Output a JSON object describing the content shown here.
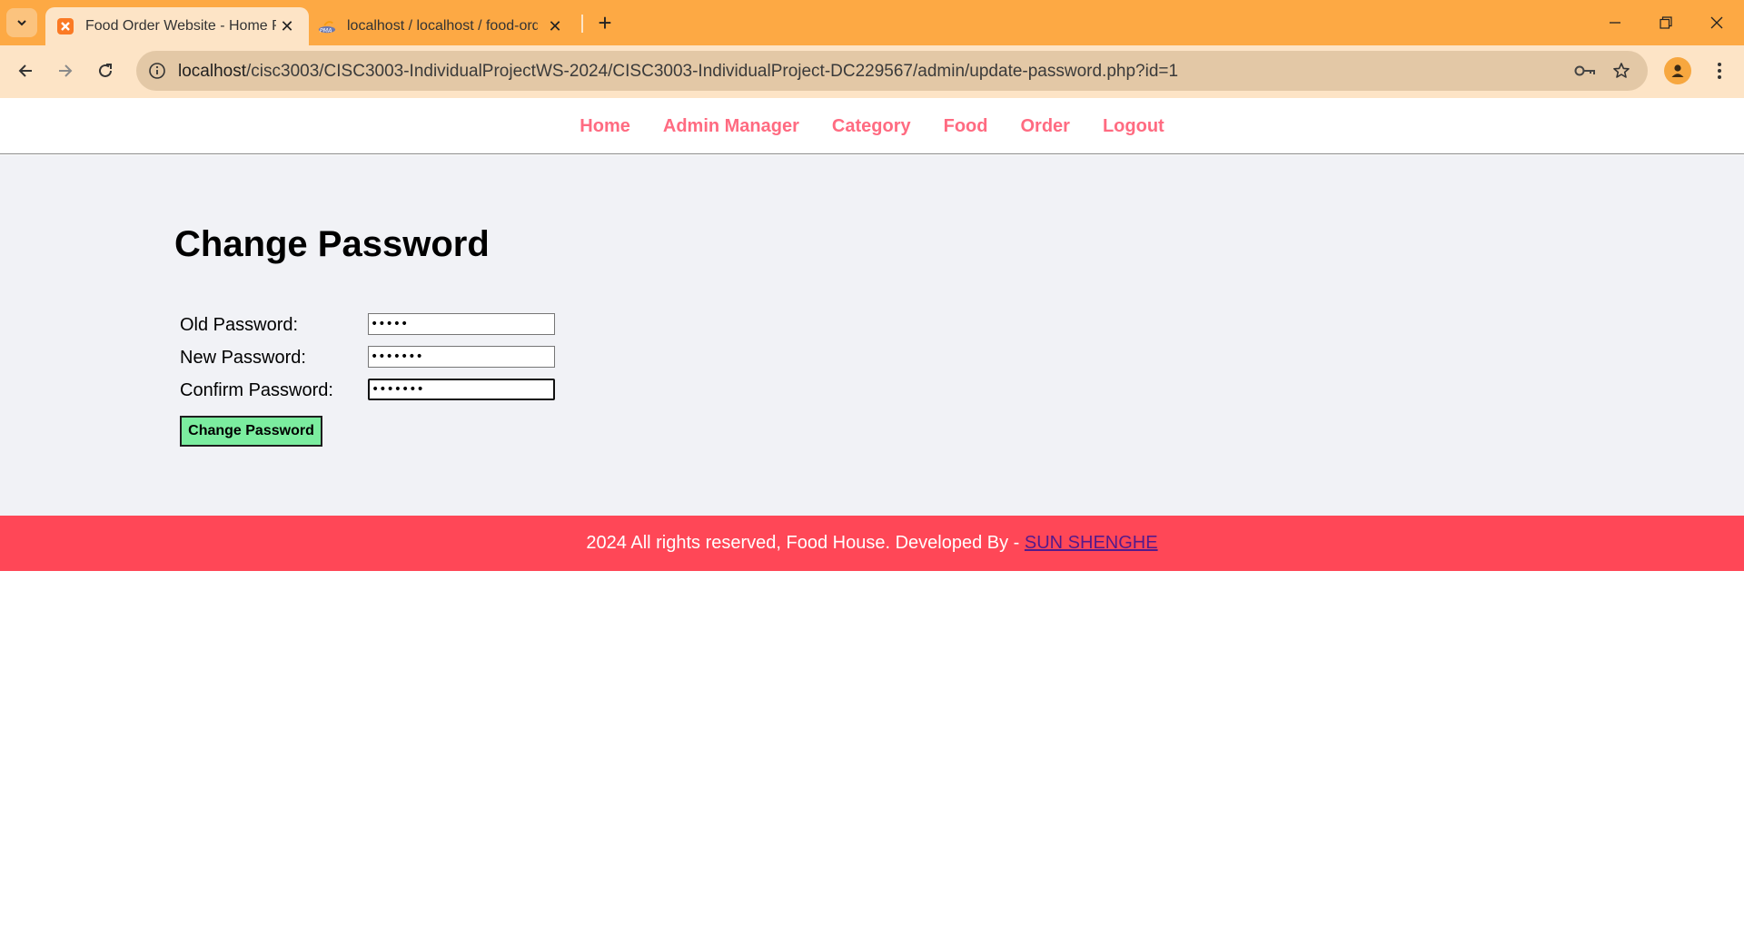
{
  "browser": {
    "tabs": [
      {
        "title": "Food Order Website - Home Page",
        "active": true
      },
      {
        "title": "localhost / localhost / food-order",
        "active": false
      }
    ],
    "url": {
      "host": "localhost",
      "path": "/cisc3003/CISC3003-IndividualProjectWS-2024/CISC3003-IndividualProject-DC229567/admin/update-password.php?id=1"
    },
    "accent_color": "#fda944"
  },
  "menu": {
    "items": [
      "Home",
      "Admin Manager",
      "Category",
      "Food",
      "Order",
      "Logout"
    ],
    "color": "#ff6b81"
  },
  "main": {
    "title": "Change Password",
    "fields": [
      {
        "label": "Old Password:",
        "value": "•••••"
      },
      {
        "label": "New Password:",
        "value": "•••••••"
      },
      {
        "label": "Confirm Password:",
        "value": "•••••••"
      }
    ],
    "submit_label": "Change Password",
    "submit_color": "#7bed9f"
  },
  "footer": {
    "text": "2024 All rights reserved, Food House. Developed By - ",
    "link": "SUN SHENGHE",
    "color": "#ff4757"
  }
}
